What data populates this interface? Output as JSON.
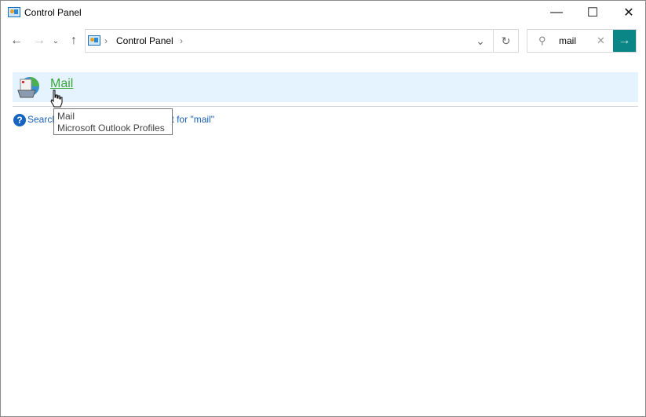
{
  "window": {
    "title": "Control Panel",
    "icon": "control-panel-icon",
    "controls": [
      "minimize",
      "maximize",
      "close"
    ]
  },
  "nav": {
    "back": "arrow-left-icon",
    "forward": "arrow-right-icon",
    "recent": "chevron-down-icon",
    "up": "arrow-up-icon"
  },
  "address": {
    "crumbs": [
      "Control Panel"
    ]
  },
  "search": {
    "value": "mail"
  },
  "colors": {
    "go_button": "#0b8686",
    "highlight": "#e5f3ff",
    "link": "#1a5fb4",
    "result_link": "#3aa63a"
  },
  "results": [
    {
      "label": "Mail",
      "icon": "mail-icon"
    }
  ],
  "help_link": {
    "text": "Search Windows Help and Support for \"mail\""
  },
  "tooltip": {
    "title": "Mail",
    "description": "Microsoft Outlook Profiles"
  }
}
